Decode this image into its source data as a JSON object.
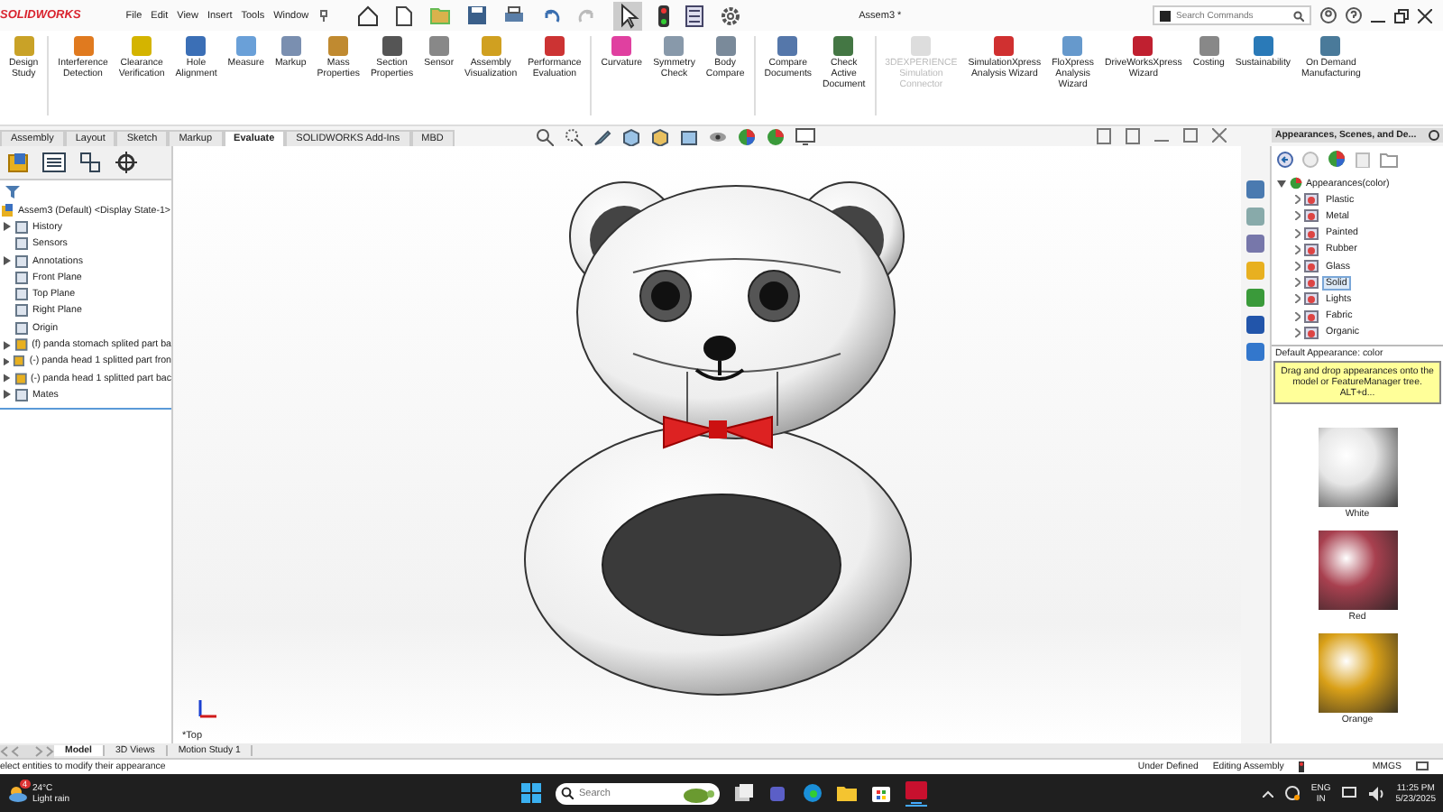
{
  "app": {
    "logo": "SOLIDWORKS",
    "menu": [
      "File",
      "Edit",
      "View",
      "Insert",
      "Tools",
      "Window"
    ],
    "title": "Assem3 *",
    "search": {
      "placeholder": "Search Commands"
    }
  },
  "ribbon": [
    {
      "label": "Design\nStudy",
      "disabled": false,
      "separator_after": true
    },
    {
      "label": "Interference\nDetection",
      "disabled": false,
      "separator_after": false
    },
    {
      "label": "Clearance\nVerification",
      "disabled": false,
      "separator_after": false
    },
    {
      "label": "Hole\nAlignment",
      "disabled": false,
      "separator_after": false
    },
    {
      "label": "Measure",
      "disabled": false,
      "separator_after": false
    },
    {
      "label": "Markup",
      "disabled": false,
      "separator_after": false
    },
    {
      "label": "Mass\nProperties",
      "disabled": false,
      "separator_after": false
    },
    {
      "label": "Section\nProperties",
      "disabled": false,
      "separator_after": false
    },
    {
      "label": "Sensor",
      "disabled": false,
      "separator_after": false
    },
    {
      "label": "Assembly\nVisualization",
      "disabled": false,
      "separator_after": false
    },
    {
      "label": "Performance\nEvaluation",
      "disabled": false,
      "separator_after": true
    },
    {
      "label": "Curvature",
      "disabled": false,
      "separator_after": false
    },
    {
      "label": "Symmetry\nCheck",
      "disabled": false,
      "separator_after": false
    },
    {
      "label": "Body\nCompare",
      "disabled": false,
      "separator_after": true
    },
    {
      "label": "Compare\nDocuments",
      "disabled": false,
      "separator_after": false
    },
    {
      "label": "Check\nActive\nDocument",
      "disabled": false,
      "separator_after": true
    },
    {
      "label": "3DEXPERIENCE\nSimulation\nConnector",
      "disabled": true,
      "separator_after": false
    },
    {
      "label": "SimulationXpress\nAnalysis Wizard",
      "disabled": false,
      "separator_after": false
    },
    {
      "label": "FloXpress\nAnalysis\nWizard",
      "disabled": false,
      "separator_after": false
    },
    {
      "label": "DriveWorksXpress\nWizard",
      "disabled": false,
      "separator_after": false
    },
    {
      "label": "Costing",
      "disabled": false,
      "separator_after": false
    },
    {
      "label": "Sustainability",
      "disabled": false,
      "separator_after": false
    },
    {
      "label": "On Demand\nManufacturing",
      "disabled": false,
      "separator_after": false
    }
  ],
  "command_tabs": [
    {
      "label": "Assembly",
      "selected": false
    },
    {
      "label": "Layout",
      "selected": false
    },
    {
      "label": "Sketch",
      "selected": false
    },
    {
      "label": "Markup",
      "selected": false
    },
    {
      "label": "Evaluate",
      "selected": true
    },
    {
      "label": "SOLIDWORKS Add-Ins",
      "selected": false
    },
    {
      "label": "MBD",
      "selected": false
    }
  ],
  "feature_tree": {
    "root": "Assem3 (Default) <Display State-1>",
    "items": [
      {
        "label": "History",
        "expandable": true
      },
      {
        "label": "Sensors",
        "expandable": false
      },
      {
        "label": "Annotations",
        "expandable": true
      },
      {
        "label": "Front Plane",
        "expandable": false
      },
      {
        "label": "Top Plane",
        "expandable": false
      },
      {
        "label": "Right Plane",
        "expandable": false
      },
      {
        "label": "Origin",
        "expandable": false
      },
      {
        "label": "(f) panda stomach splited part ba",
        "expandable": true
      },
      {
        "label": "(-) panda head 1 splitted part fron",
        "expandable": true
      },
      {
        "label": "(-) panda head 1 splitted part bac",
        "expandable": true
      },
      {
        "label": "Mates",
        "expandable": true
      }
    ]
  },
  "viewport": {
    "view_label": "*Top"
  },
  "task_pane": {
    "title": "Appearances, Scenes, and De...",
    "root": "Appearances(color)",
    "folders": [
      {
        "label": "Plastic",
        "selected": false
      },
      {
        "label": "Metal",
        "selected": false
      },
      {
        "label": "Painted",
        "selected": false
      },
      {
        "label": "Rubber",
        "selected": false
      },
      {
        "label": "Glass",
        "selected": false
      },
      {
        "label": "Solid",
        "selected": true
      },
      {
        "label": "Lights",
        "selected": false
      },
      {
        "label": "Fabric",
        "selected": false
      },
      {
        "label": "Organic",
        "selected": false
      }
    ],
    "default_label": "Default Appearance: color",
    "tooltip": "Drag and drop appearances onto the model or FeatureManager tree.  ALT+d...",
    "swatches": [
      {
        "name": "White",
        "color": "#e6e6e6"
      },
      {
        "name": "Red",
        "color": "#a8404f"
      },
      {
        "name": "Orange",
        "color": "#d9a018"
      }
    ]
  },
  "bottom_tabs": [
    {
      "label": "Model",
      "selected": true
    },
    {
      "label": "3D Views",
      "selected": false
    },
    {
      "label": "Motion Study 1",
      "selected": false
    }
  ],
  "status_bar": {
    "message": "elect entities to modify their appearance",
    "state": "Under Defined",
    "mode": "Editing Assembly",
    "units": "MMGS"
  },
  "taskbar": {
    "weather_badge": "4",
    "temperature": "24°C",
    "weather": "Light rain",
    "search_placeholder": "Search",
    "language": "ENG",
    "region": "IN",
    "time": "11:25 PM",
    "date": "5/23/2025"
  }
}
